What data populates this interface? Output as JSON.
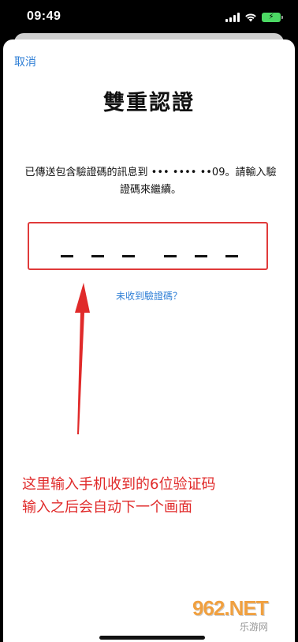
{
  "status_bar": {
    "time": "09:49",
    "signal_icon": "signal-bars-icon",
    "wifi_icon": "wifi-icon",
    "battery_icon": "battery-charging-icon",
    "battery_color": "#4cd964"
  },
  "nav": {
    "cancel_label": "取消"
  },
  "page": {
    "title": "雙重認證",
    "message": "已傳送包含驗證碼的訊息到 ••• •••• ••09。請輸入驗證碼來繼續。",
    "resend_label": "未收到驗證碼？"
  },
  "code_input": {
    "length": 6,
    "value": "",
    "highlight_color": "#e03a3a"
  },
  "annotation": {
    "line1": "这里输入手机收到的6位验证码",
    "line2": "输入之后会自动下一个画面",
    "color": "#e02a2a"
  },
  "watermark": {
    "main": "962.NET",
    "sub": "乐游网"
  },
  "colors": {
    "accent": "#2f7fd6"
  }
}
